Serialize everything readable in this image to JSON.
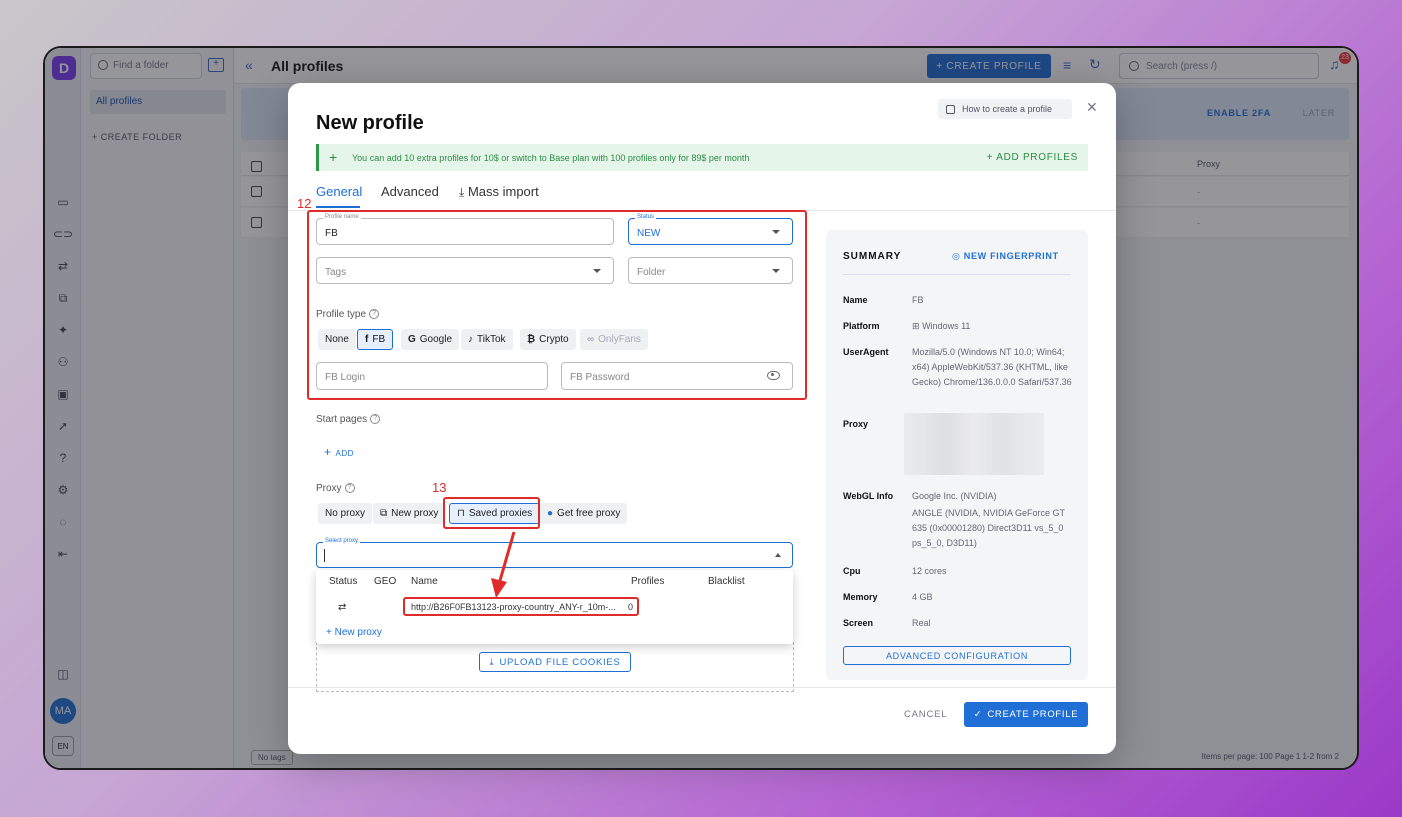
{
  "app": {
    "find_folder_placeholder": "Find a folder",
    "all_profiles_item": "All profiles",
    "create_folder": "+ CREATE FOLDER",
    "page_title": "All profiles",
    "create_profile_top": "+ CREATE PROFILE",
    "search_placeholder": "Search (press /)",
    "notification_count": "23",
    "enable_2fa": "ENABLE 2FA",
    "later": "LATER",
    "proxy_col": "Proxy",
    "row_dash": "-",
    "avatar": "MA",
    "lang": "EN",
    "no_tags": "No tags",
    "pagination": "Items per page: 100   Page 1   1-2 from 2"
  },
  "modal": {
    "title": "New profile",
    "how_to": "How to create a profile",
    "promo_text": "You can add 10 extra profiles for 10$ or switch to Base plan with 100 profiles only for 89$ per month",
    "add_profiles": "+ ADD PROFILES",
    "tabs": [
      "General",
      "Advanced",
      "Mass import"
    ],
    "profile_name_label": "Profile name",
    "profile_name_value": "FB",
    "status_label": "Status",
    "status_value": "NEW",
    "tags_placeholder": "Tags",
    "folder_placeholder": "Folder",
    "profile_type_label": "Profile type",
    "profile_types": [
      {
        "icon": "",
        "label": "None"
      },
      {
        "icon": "f",
        "label": "FB"
      },
      {
        "icon": "G",
        "label": "Google"
      },
      {
        "icon": "♪",
        "label": "TikTok"
      },
      {
        "icon": "₿",
        "label": "Crypto"
      },
      {
        "icon": "∞",
        "label": "OnlyFans"
      }
    ],
    "fb_login_placeholder": "FB Login",
    "fb_password_placeholder": "FB Password",
    "start_pages_label": "Start pages",
    "add_label": "ADD",
    "proxy_label": "Proxy",
    "proxy_options": [
      "No proxy",
      "New proxy",
      "Saved proxies",
      "Get free proxy"
    ],
    "select_proxy_label": "Select proxy",
    "dropdown": {
      "headers": [
        "Status",
        "GEO",
        "Name",
        "Profiles",
        "Blacklist"
      ],
      "row_name": "http://B26F0FB13123-proxy-country_ANY-r_10m-...",
      "row_profiles": "0",
      "new_proxy": "+ New proxy"
    },
    "upload_cookies": "UPLOAD FILE COOKIES",
    "cancel": "CANCEL",
    "create": "CREATE PROFILE"
  },
  "summary": {
    "title": "SUMMARY",
    "new_fingerprint": "NEW FINGERPRINT",
    "name_k": "Name",
    "name_v": "FB",
    "platform_k": "Platform",
    "platform_v": "Windows 11",
    "ua_k": "UserAgent",
    "ua_v": "Mozilla/5.0 (Windows NT 10.0; Win64; x64) AppleWebKit/537.36 (KHTML, like Gecko) Chrome/136.0.0.0 Safari/537.36",
    "proxy_k": "Proxy",
    "webgl_k": "WebGL Info",
    "webgl_v1": "Google Inc. (NVIDIA)",
    "webgl_v2": "ANGLE (NVIDIA, NVIDIA GeForce GT 635 (0x00001280) Direct3D11 vs_5_0 ps_5_0, D3D11)",
    "cpu_k": "Cpu",
    "cpu_v": "12 cores",
    "memory_k": "Memory",
    "memory_v": "4 GB",
    "screen_k": "Screen",
    "screen_v": "Real",
    "advanced": "ADVANCED CONFIGURATION"
  },
  "annotations": {
    "a12": "12",
    "a13": "13"
  },
  "colors": {
    "accent": "#1f6fd6",
    "highlight": "#e02b2b",
    "promo": "#2b9a48"
  }
}
